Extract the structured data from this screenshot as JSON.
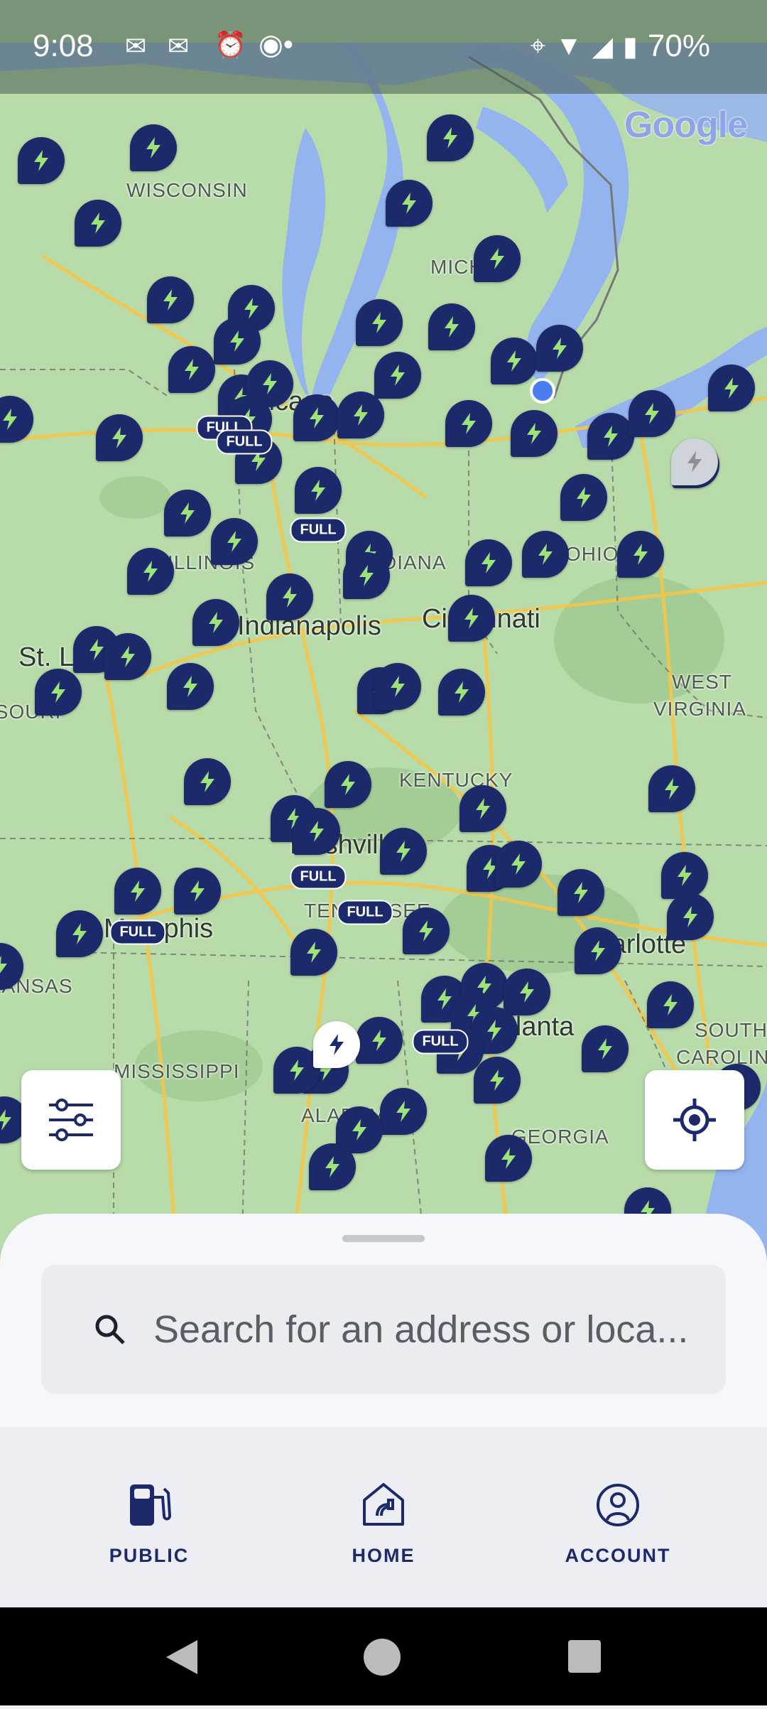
{
  "status_bar": {
    "time": "9:08",
    "battery": "70%",
    "icons": [
      "gmail-icon",
      "gmail-icon",
      "alarm-icon",
      "record-icon",
      "location-icon",
      "wifi-icon",
      "signal-icon",
      "battery-icon"
    ]
  },
  "map": {
    "attribution": "Google",
    "state_labels": [
      "WISCONSIN",
      "MICHI",
      "ILLINOIS",
      "INDIANA",
      "OHIO",
      "KENTUCKY",
      "WEST",
      "VIRGINIA",
      "TENNESSEE",
      "MISSISSIPPI",
      "ALABAMA",
      "GEORGIA",
      "SOUTH",
      "CAROLIN",
      "ARKANSAS",
      "MISSOURI"
    ],
    "city_labels": [
      "Indianapolis",
      "Cincinnati",
      "St. Louis",
      "Nashville",
      "Memphis",
      "Charlotte",
      "Atlanta",
      "Chicago"
    ],
    "full_badge": "FULL",
    "pin_color": "#1c2a6b"
  },
  "controls": {
    "filter_icon": "sliders-icon",
    "locate_icon": "crosshair-icon"
  },
  "search": {
    "placeholder": "Search for an address or loca..."
  },
  "nav": {
    "public": "PUBLIC",
    "home": "HOME",
    "account": "ACCOUNT"
  }
}
